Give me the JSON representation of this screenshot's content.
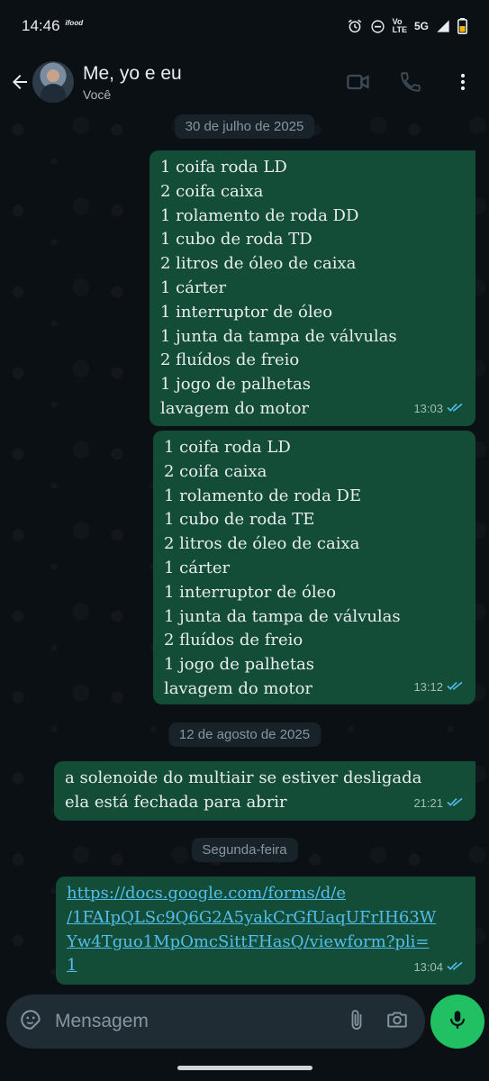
{
  "status_bar": {
    "time": "14:46",
    "carrier_badge": "ifood",
    "volte_top": "Vo",
    "volte_bottom": "LTE",
    "network": "5G"
  },
  "header": {
    "contact_name": "Me, yo e eu",
    "subtitle": "Você"
  },
  "messages": [
    {
      "type": "date",
      "label": "30 de julho de 2025"
    },
    {
      "type": "out",
      "lines": [
        "1 coifa roda LD",
        "2 coifa caixa",
        "1 rolamento de roda DD",
        "1 cubo de roda TD",
        "2 litros de óleo de caixa",
        "1 cárter",
        "1 interruptor de óleo",
        "1 junta da tampa de válvulas",
        "2 fluídos de freio",
        "1 jogo de palhetas",
        "lavagem do motor"
      ],
      "time": "13:03",
      "status": "read"
    },
    {
      "type": "out",
      "lines": [
        "1 coifa roda LD",
        "2 coifa caixa",
        "1 rolamento de roda DE",
        "1 cubo de roda TE",
        "2 litros de óleo de caixa",
        "1 cárter",
        "1 interruptor de óleo",
        "1 junta da tampa de válvulas",
        "2 fluídos de freio",
        "1 jogo de palhetas",
        "lavagem do motor"
      ],
      "time": "13:12",
      "status": "read"
    },
    {
      "type": "date",
      "label": "12 de agosto de 2025"
    },
    {
      "type": "out",
      "lines": [
        "a solenoide do multiair se estiver desligada",
        "ela está fechada para abrir"
      ],
      "time": "21:21",
      "status": "read"
    },
    {
      "type": "date",
      "label": "Segunda-feira"
    },
    {
      "type": "out",
      "link_lines": [
        "https://docs.google.com/forms/d/e",
        "/1FAIpQLSc9Q6G2A5yakCrGfUaqUFrIH63W",
        "Yw4Tguo1MpOmcSittFHasQ/viewform?pli=",
        "1"
      ],
      "time": "13:04",
      "status": "read"
    }
  ],
  "composer": {
    "placeholder": "Mensagem"
  },
  "colors": {
    "background": "#0b1014",
    "bubble_out": "#144d37",
    "date_chip": "#182229",
    "accent_green": "#21c063",
    "read_ticks": "#53bdeb",
    "link": "#53bdeb"
  },
  "icons": {
    "header": [
      "back-arrow-icon",
      "video-call-icon",
      "voice-call-icon",
      "more-options-icon"
    ],
    "composer": [
      "sticker-icon",
      "attach-icon",
      "camera-icon",
      "mic-icon"
    ],
    "status": [
      "alarm-icon",
      "do-not-disturb-icon",
      "signal-icon",
      "battery-icon"
    ]
  }
}
